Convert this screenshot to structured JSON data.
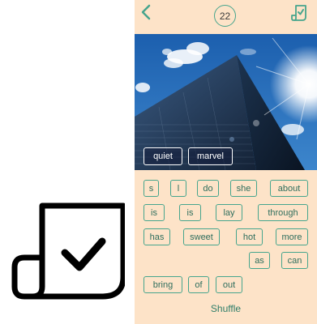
{
  "header": {
    "score": "22"
  },
  "icons": {
    "back": "chevron-left-icon",
    "done": "document-check-icon",
    "logo": "document-check-logo"
  },
  "answer": {
    "words": [
      "quiet",
      "marvel"
    ]
  },
  "tiles": {
    "row1": [
      "s",
      "l",
      "do",
      "she",
      "about"
    ],
    "row2": [
      "is",
      "is",
      "lay",
      "through"
    ],
    "row3": [
      "has",
      "sweet",
      "hot",
      "more"
    ],
    "row4": [
      "as",
      "can"
    ],
    "row5": [
      "bring",
      "of",
      "out"
    ]
  },
  "footer": {
    "shuffle_label": "Shuffle"
  },
  "colors": {
    "background": "#fde3c8",
    "accent": "#46a58d",
    "text": "#2f6e5d"
  }
}
